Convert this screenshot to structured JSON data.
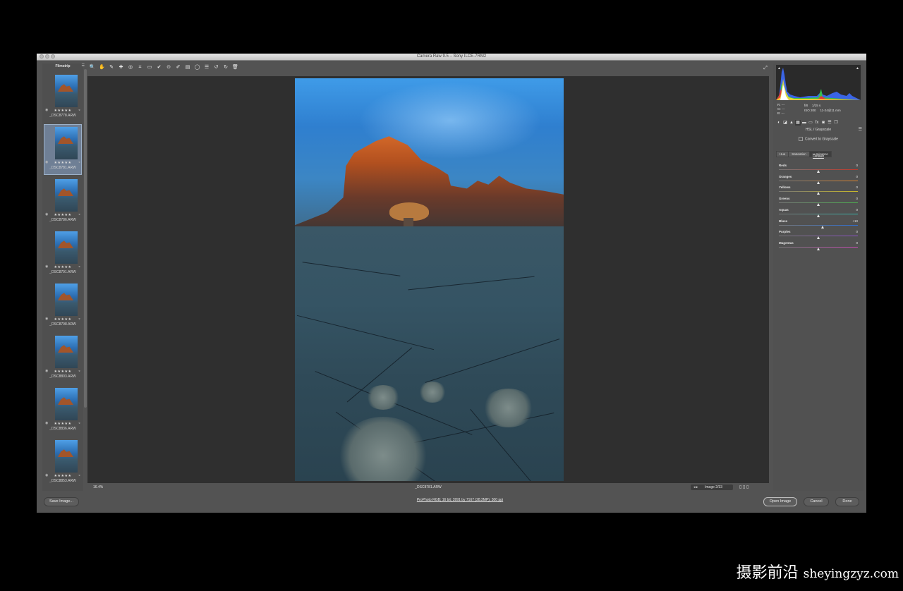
{
  "window": {
    "title": "Camera Raw 9.5  –  Sony ILCE-7RM2"
  },
  "filmstrip": {
    "header": "Filmstrip",
    "menu_icon": "☰",
    "items": [
      {
        "filename": "_DSC8778.ARW",
        "stars": "★★★★★",
        "selected": false
      },
      {
        "filename": "_DSC8781.ARW",
        "stars": "★★★★★",
        "selected": true
      },
      {
        "filename": "_DSC8786.ARW",
        "stars": "★★★★★",
        "selected": false
      },
      {
        "filename": "_DSC8791.ARW",
        "stars": "★★★★★",
        "selected": false
      },
      {
        "filename": "_DSC8798.ARW",
        "stars": "★★★★★",
        "selected": false
      },
      {
        "filename": "_DSC8803.ARW",
        "stars": "★★★★★",
        "selected": false
      },
      {
        "filename": "_DSC8836.ARW",
        "stars": "★★★★★",
        "selected": false
      },
      {
        "filename": "_DSC8853.ARW",
        "stars": "★★★★★",
        "selected": false
      }
    ]
  },
  "toolbar": {
    "tools": [
      {
        "name": "zoom-tool-icon",
        "glyph": "🔍"
      },
      {
        "name": "hand-tool-icon",
        "glyph": "✋"
      },
      {
        "name": "white-balance-tool-icon",
        "glyph": "✎"
      },
      {
        "name": "color-sampler-tool-icon",
        "glyph": "✚"
      },
      {
        "name": "targeted-adjustment-tool-icon",
        "glyph": "◎"
      },
      {
        "name": "crop-tool-icon",
        "glyph": "⌗"
      },
      {
        "name": "straighten-tool-icon",
        "glyph": "▭"
      },
      {
        "name": "spot-removal-tool-icon",
        "glyph": "✔"
      },
      {
        "name": "red-eye-tool-icon",
        "glyph": "⊙"
      },
      {
        "name": "adjustment-brush-icon",
        "glyph": "✐"
      },
      {
        "name": "graduated-filter-icon",
        "glyph": "▤"
      },
      {
        "name": "radial-filter-icon",
        "glyph": "◯"
      },
      {
        "name": "preferences-icon",
        "glyph": "☰"
      },
      {
        "name": "rotate-left-icon",
        "glyph": "↺"
      },
      {
        "name": "rotate-right-icon",
        "glyph": "↻"
      },
      {
        "name": "trash-icon",
        "glyph": "🗑"
      }
    ],
    "fullscreen_glyph": "⤢"
  },
  "statusbar": {
    "zoom": "16.4%",
    "filename": "_DSC8781.ARW",
    "page_arrows": "◂ ▸",
    "image_counter": "Image 2/33"
  },
  "histogram": {
    "shadow_warn": "▲",
    "highlight_warn": "▲",
    "rgb": [
      "R: ---",
      "G: ---",
      "B: ---"
    ],
    "meta_line1": [
      "f/8",
      "1/15 s"
    ],
    "meta_line2": [
      "ISO 200",
      "11-24@11 mm"
    ]
  },
  "panel": {
    "title": "HSL / Grayscale",
    "menu_glyph": "☰",
    "convert_label": "Convert to Grayscale",
    "subtabs": [
      {
        "label": "Hue",
        "selected": false
      },
      {
        "label": "Saturation",
        "selected": false
      },
      {
        "label": "Luminance",
        "selected": true
      }
    ],
    "default_link": "Default",
    "sliders": [
      {
        "label": "Reds",
        "value": "0",
        "pos": 0.5,
        "color": "#c0392b"
      },
      {
        "label": "Oranges",
        "value": "0",
        "pos": 0.5,
        "color": "#d9822b"
      },
      {
        "label": "Yellows",
        "value": "0",
        "pos": 0.5,
        "color": "#c9b92a"
      },
      {
        "label": "Greens",
        "value": "0",
        "pos": 0.5,
        "color": "#4caf50"
      },
      {
        "label": "Aquas",
        "value": "0",
        "pos": 0.5,
        "color": "#35b3a8"
      },
      {
        "label": "Blues",
        "value": "+10",
        "pos": 0.55,
        "color": "#2f6ed1"
      },
      {
        "label": "Purples",
        "value": "0",
        "pos": 0.5,
        "color": "#8a4fc5"
      },
      {
        "label": "Magentas",
        "value": "0",
        "pos": 0.5,
        "color": "#c74ab4"
      }
    ]
  },
  "bottom": {
    "save_label": "Save Image...",
    "workflow_link": "ProPhoto RGB; 16 bit; 3991 by 7167 (28.2MP); 300 ppi",
    "open_label": "Open Image",
    "cancel_label": "Cancel",
    "done_label": "Done"
  },
  "watermark": {
    "cn": "摄影前沿",
    "en": "sheyingzyz.com"
  }
}
